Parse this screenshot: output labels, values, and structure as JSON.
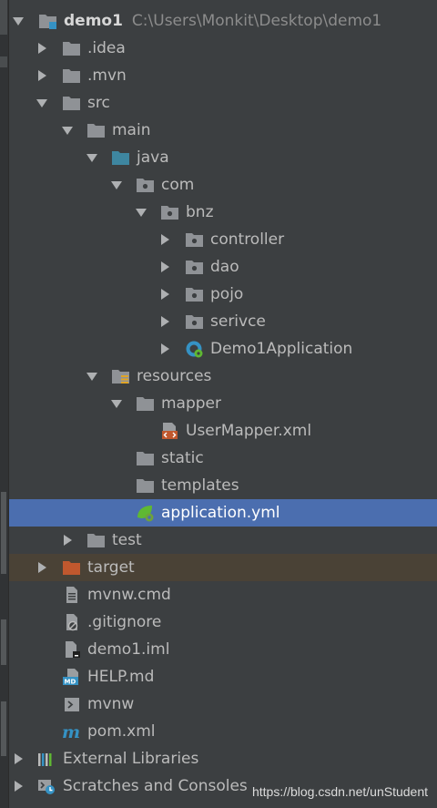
{
  "tree": {
    "project": {
      "name": "demo1",
      "path": "C:\\Users\\Monkit\\Desktop\\demo1"
    },
    "idea": ".idea",
    "mvn": ".mvn",
    "src": "src",
    "main": "main",
    "java": "java",
    "com": "com",
    "bnz": "bnz",
    "controller": "controller",
    "dao": "dao",
    "pojo": "pojo",
    "serivce": "serivce",
    "app_class": "Demo1Application",
    "resources": "resources",
    "mapper": "mapper",
    "user_mapper": "UserMapper.xml",
    "static": "static",
    "templates": "templates",
    "application_yml": "application.yml",
    "test": "test",
    "target": "target",
    "mvnw_cmd": "mvnw.cmd",
    "gitignore": ".gitignore",
    "iml": "demo1.iml",
    "help": "HELP.md",
    "mvnw": "mvnw",
    "pom": "pom.xml",
    "external_libraries": "External Libraries",
    "scratches": "Scratches and Consoles"
  },
  "icons": {
    "folder": "folder-icon",
    "module": "module-icon",
    "source_folder": "source-folder-icon",
    "package": "package-icon",
    "spring_boot": "spring-boot-app-icon",
    "resources": "resources-folder-icon",
    "xml": "xml-file-icon",
    "yml": "spring-yml-icon",
    "excluded": "excluded-folder-icon",
    "text_file": "text-file-icon",
    "ignore_file": "ignore-file-icon",
    "iml_file": "iml-file-icon",
    "markdown": "markdown-file-icon",
    "script": "shell-script-icon",
    "maven": "maven-icon",
    "libraries": "libraries-icon",
    "scratches": "scratches-icon"
  },
  "colors": {
    "background": "#3c3f41",
    "selection": "#4b6eaf",
    "excluded_row": "#4a4236",
    "folder": "#8f9296",
    "source_folder": "#3e86a0",
    "excluded_folder": "#c0582e",
    "spring_green": "#5fb832"
  },
  "watermark": "https://blog.csdn.net/unStudent"
}
